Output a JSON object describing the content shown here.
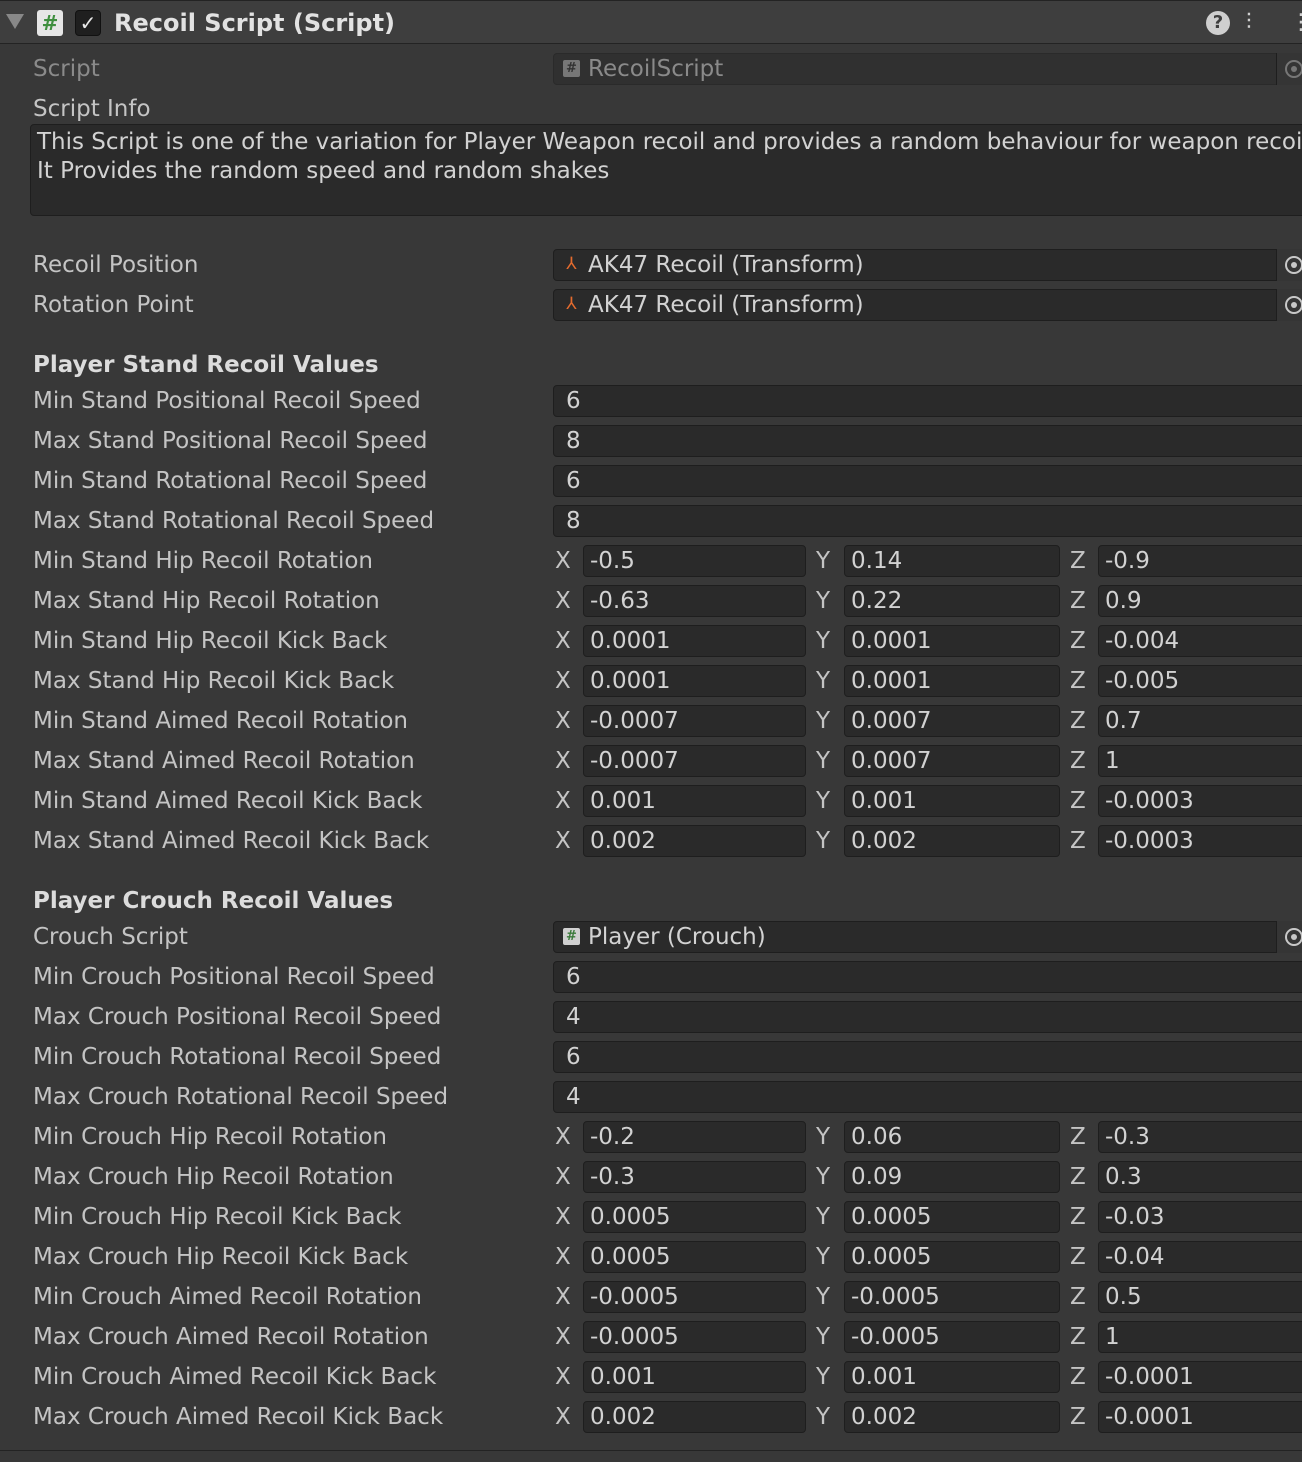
{
  "component": {
    "title": "Recoil Script (Script)",
    "enabled": true,
    "script_label": "Script",
    "script_value": "RecoilScript"
  },
  "script_info": {
    "label": "Script Info",
    "text": "This Script is one of the variation for Player Weapon recoil and provides a random behaviour for weapon recoil .\nIt Provides the random speed and random shakes"
  },
  "transforms": [
    {
      "label": "Recoil Position",
      "value": "AK47 Recoil (Transform)"
    },
    {
      "label": "Rotation Point",
      "value": "AK47 Recoil (Transform)"
    }
  ],
  "stand": {
    "header": "Player Stand Recoil Values",
    "floats": [
      {
        "label": "Min Stand Positional Recoil Speed",
        "value": "6"
      },
      {
        "label": "Max Stand Positional Recoil Speed",
        "value": "8"
      },
      {
        "label": "Min Stand Rotational Recoil Speed",
        "value": "6"
      },
      {
        "label": "Max Stand Rotational Recoil Speed",
        "value": "8"
      }
    ],
    "vectors": [
      {
        "label": "Min Stand Hip Recoil Rotation",
        "x": "-0.5",
        "y": "0.14",
        "z": "-0.9"
      },
      {
        "label": "Max Stand Hip Recoil Rotation",
        "x": "-0.63",
        "y": "0.22",
        "z": "0.9"
      },
      {
        "label": "Min Stand Hip Recoil Kick Back",
        "x": "0.0001",
        "y": "0.0001",
        "z": "-0.004"
      },
      {
        "label": "Max Stand Hip Recoil Kick Back",
        "x": "0.0001",
        "y": "0.0001",
        "z": "-0.005"
      },
      {
        "label": "Min Stand Aimed Recoil Rotation",
        "x": "-0.0007",
        "y": "0.0007",
        "z": "0.7"
      },
      {
        "label": "Max Stand Aimed Recoil Rotation",
        "x": "-0.0007",
        "y": "0.0007",
        "z": "1"
      },
      {
        "label": "Min Stand Aimed Recoil Kick Back",
        "x": "0.001",
        "y": "0.001",
        "z": "-0.0003"
      },
      {
        "label": "Max Stand Aimed Recoil Kick Back",
        "x": "0.002",
        "y": "0.002",
        "z": "-0.0003"
      }
    ]
  },
  "crouch": {
    "header": "Player Crouch Recoil Values",
    "script_label": "Crouch Script",
    "script_value": "Player (Crouch)",
    "floats": [
      {
        "label": "Min Crouch Positional Recoil Speed",
        "value": "6"
      },
      {
        "label": "Max Crouch Positional Recoil Speed",
        "value": "4"
      },
      {
        "label": "Min Crouch Rotational Recoil Speed",
        "value": "6"
      },
      {
        "label": "Max Crouch Rotational Recoil Speed",
        "value": "4"
      }
    ],
    "vectors": [
      {
        "label": "Min Crouch Hip Recoil Rotation",
        "x": "-0.2",
        "y": "0.06",
        "z": "-0.3"
      },
      {
        "label": "Max Crouch Hip Recoil Rotation",
        "x": "-0.3",
        "y": "0.09",
        "z": "0.3"
      },
      {
        "label": "Min Crouch Hip Recoil Kick Back",
        "x": "0.0005",
        "y": "0.0005",
        "z": "-0.03"
      },
      {
        "label": "Max Crouch Hip Recoil Kick Back",
        "x": "0.0005",
        "y": "0.0005",
        "z": "-0.04"
      },
      {
        "label": "Min Crouch Aimed Recoil Rotation",
        "x": "-0.0005",
        "y": "-0.0005",
        "z": "0.5"
      },
      {
        "label": "Max Crouch Aimed Recoil Rotation",
        "x": "-0.0005",
        "y": "-0.0005",
        "z": "1"
      },
      {
        "label": "Min Crouch Aimed Recoil Kick Back",
        "x": "0.001",
        "y": "0.001",
        "z": "-0.0001"
      },
      {
        "label": "Max Crouch Aimed Recoil Kick Back",
        "x": "0.002",
        "y": "0.002",
        "z": "-0.0001"
      }
    ]
  },
  "axis_labels": {
    "x": "X",
    "y": "Y",
    "z": "Z"
  },
  "icons": {
    "foldout": "triangle-down-icon",
    "script": "script-hash-icon",
    "help": "help-icon",
    "presets": "presets-sliders-icon",
    "menu": "kebab-menu-icon",
    "transform": "transform-axes-icon",
    "picker": "object-picker-icon"
  },
  "colors": {
    "background": "#383838",
    "header": "#3e3e3e",
    "field": "#2a2a2a",
    "text": "#c4c4c4"
  }
}
